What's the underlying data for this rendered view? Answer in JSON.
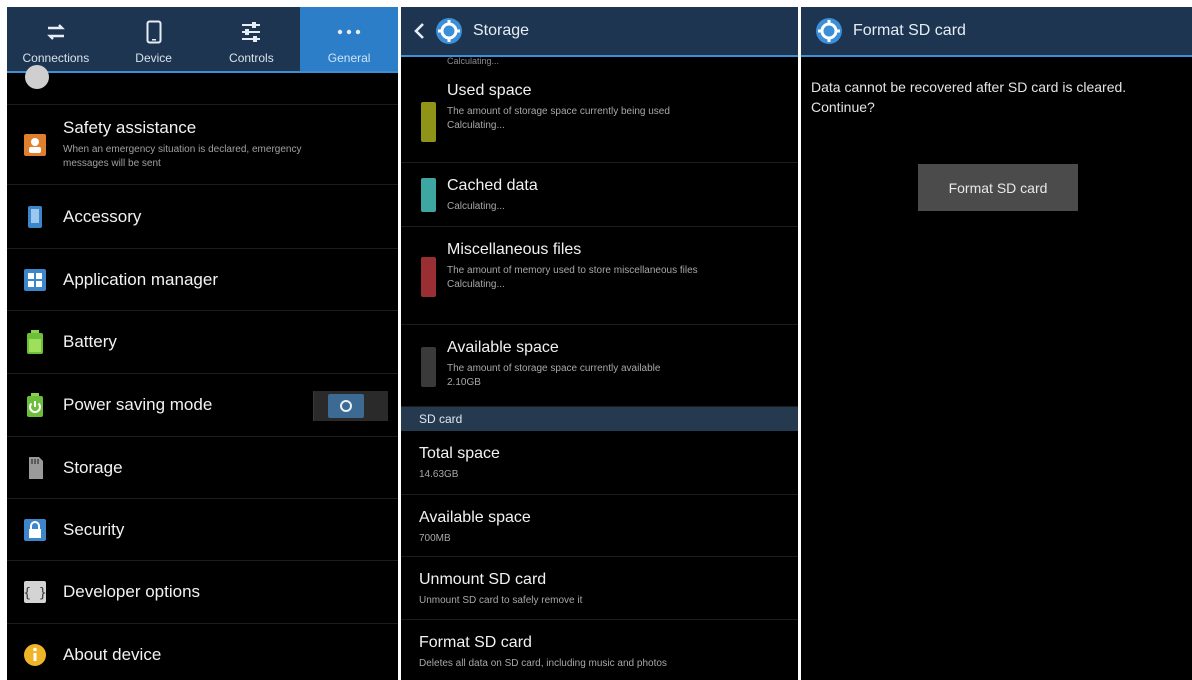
{
  "settings": {
    "tabs": [
      {
        "label": "Connections",
        "icon": "connections-arrows-icon",
        "active": false
      },
      {
        "label": "Device",
        "icon": "device-phone-icon",
        "active": false
      },
      {
        "label": "Controls",
        "icon": "controls-sliders-icon",
        "active": false
      },
      {
        "label": "General",
        "icon": "more-dots-icon",
        "active": true
      }
    ],
    "items": [
      {
        "title": "Safety assistance",
        "subtitle": "When an emergency situation is declared, emergency messages will be sent",
        "icon": "safety-assistance-icon"
      },
      {
        "title": "Accessory",
        "icon": "accessory-icon"
      },
      {
        "title": "Application manager",
        "icon": "application-manager-icon"
      },
      {
        "title": "Battery",
        "icon": "battery-icon"
      },
      {
        "title": "Power saving mode",
        "icon": "power-saving-icon",
        "toggle_state": "off"
      },
      {
        "title": "Storage",
        "icon": "storage-icon"
      },
      {
        "title": "Security",
        "icon": "security-lock-icon"
      },
      {
        "title": "Developer options",
        "icon": "developer-options-icon"
      },
      {
        "title": "About device",
        "icon": "about-device-icon"
      }
    ]
  },
  "storage": {
    "header_title": "Storage",
    "top_partial": "Calculating...",
    "items": [
      {
        "title": "Used space",
        "subtitle": "The amount of storage space currently being used",
        "value": "Calculating...",
        "color": "#8f9418"
      },
      {
        "title": "Cached data",
        "value": "Calculating...",
        "color": "#3fa7a1"
      },
      {
        "title": "Miscellaneous files",
        "subtitle": "The amount of memory used to store miscellaneous files",
        "value": "Calculating...",
        "color": "#9a2f33"
      },
      {
        "title": "Available space",
        "subtitle": "The amount of storage space currently available",
        "value": "2.10GB",
        "color": "#3a3a3a"
      }
    ],
    "sd_section_label": "SD card",
    "sd_items": [
      {
        "title": "Total space",
        "value": "14.63GB"
      },
      {
        "title": "Available space",
        "value": "700MB"
      },
      {
        "title": "Unmount SD card",
        "value": "Unmount SD card to safely remove it"
      },
      {
        "title": "Format SD card",
        "value": "Deletes all data on SD card, including music and photos"
      }
    ]
  },
  "format": {
    "header_title": "Format SD card",
    "message": "Data cannot be recovered after SD card is cleared. Continue?",
    "button_label": "Format SD card"
  },
  "colors": {
    "header_bg": "#1d3550",
    "accent": "#2d7ec8"
  }
}
